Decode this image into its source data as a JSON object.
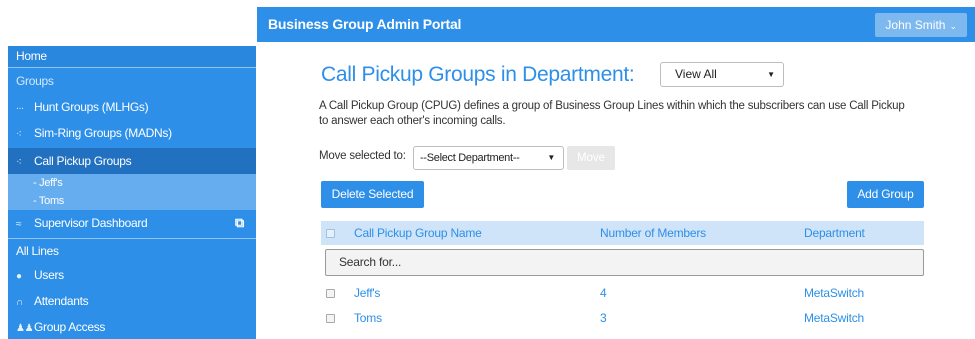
{
  "header": {
    "title": "Business Group Admin Portal",
    "user": "John Smith"
  },
  "sidebar": {
    "home": "Home",
    "groups_heading": "Groups",
    "hunt_groups": "Hunt Groups (MLHGs)",
    "sim_ring": "Sim-Ring Groups (MADNs)",
    "call_pickup": "Call Pickup Groups",
    "sub_items": [
      "- Jeff's",
      "- Toms"
    ],
    "supervisor": "Supervisor Dashboard",
    "all_lines": "All Lines",
    "users": "Users",
    "attendants": "Attendants",
    "group_access": "Group Access"
  },
  "main": {
    "title": "Call Pickup Groups in Department:",
    "view_select": "View All",
    "description": "A Call Pickup Group (CPUG) defines a group of Business Group Lines within which the subscribers can use Call Pickup to answer each other's incoming calls.",
    "move_label": "Move selected to:",
    "dept_select": "--Select Department--",
    "move_button": "Move",
    "delete_button": "Delete Selected",
    "add_button": "Add Group",
    "columns": [
      "Call Pickup Group Name",
      "Number of Members",
      "Department"
    ],
    "search_placeholder": "Search for...",
    "rows": [
      {
        "name": "Jeff's",
        "members": "4",
        "department": "MetaSwitch"
      },
      {
        "name": "Toms",
        "members": "3",
        "department": "MetaSwitch"
      }
    ]
  },
  "colors": {
    "accent": "#2d8fe8",
    "sidebar_active": "#2271c0",
    "table_header_bg": "#cfe4f8"
  }
}
